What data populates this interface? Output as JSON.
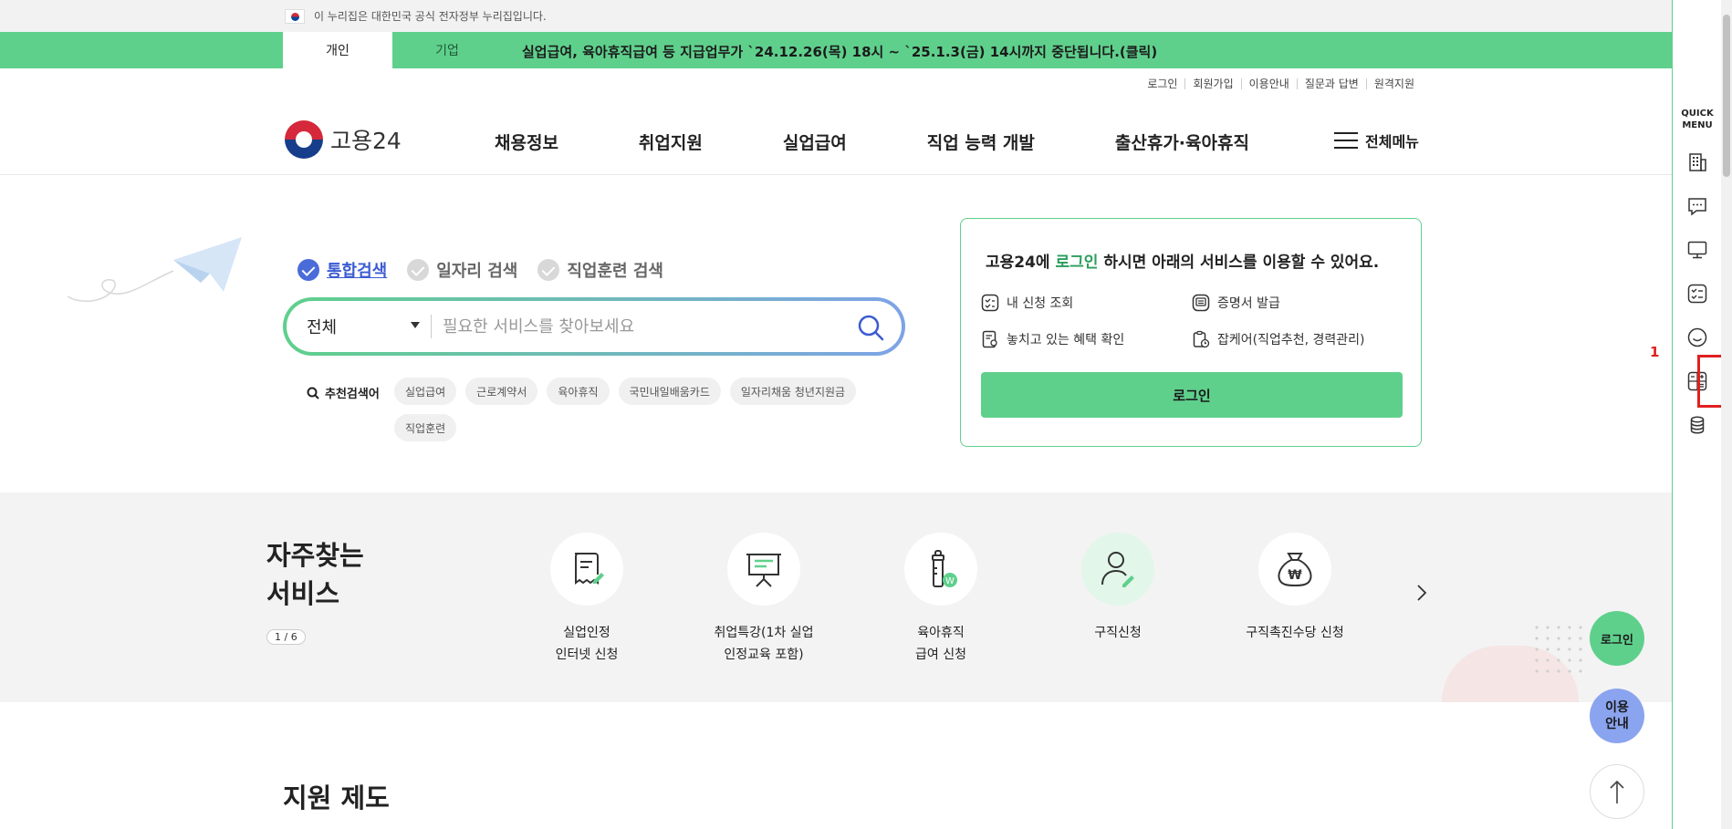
{
  "gov_banner": {
    "text": "이 누리집은 대한민국 공식 전자정부 누리집입니다."
  },
  "notice": {
    "tabs": [
      "개인",
      "기업"
    ],
    "text": "실업급여, 육아휴직급여 등 지급업무가 `24.12.26(목) 18시 ~ `25.1.3(금) 14시까지 중단됩니다.(클릭)"
  },
  "util_links": [
    "로그인",
    "회원가입",
    "이용안내",
    "질문과 답변",
    "원격지원"
  ],
  "header": {
    "logo_text": "고용24",
    "nav": [
      "채용정보",
      "취업지원",
      "실업급여",
      "직업 능력 개발",
      "출산휴가·육아휴직"
    ],
    "all_menu": "전체메뉴"
  },
  "search": {
    "tabs": [
      "통합검색",
      "일자리 검색",
      "직업훈련 검색"
    ],
    "select_value": "전체",
    "placeholder": "필요한 서비스를 찾아보세요",
    "recommend_label": "추천검색어",
    "tags": [
      "실업급여",
      "근로계약서",
      "육아휴직",
      "국민내일배움카드",
      "일자리채움 청년지원금",
      "직업훈련"
    ]
  },
  "login_box": {
    "title_pre": "고용24에 ",
    "title_hl": "로그인",
    "title_post": " 하시면 아래의 서비스를 이용할 수 있어요.",
    "services": [
      "내 신청 조회",
      "증명서 발급",
      "놓치고 있는 혜택 확인",
      "잡케어(직업추천, 경력관리)"
    ],
    "button": "로그인"
  },
  "frequent": {
    "title": "자주찾는\n서비스",
    "pager": "1 / 6",
    "items": [
      {
        "label": "실업인정\n인터넷 신청",
        "icon": "document-edit-icon"
      },
      {
        "label": "취업특강(1차 실업\n인정교육 포함)",
        "icon": "presentation-board-icon"
      },
      {
        "label": "육아휴직\n급여 신청",
        "icon": "baby-bottle-icon"
      },
      {
        "label": "구직신청",
        "icon": "person-edit-icon"
      },
      {
        "label": "구직촉진수당 신청",
        "icon": "money-bag-icon"
      }
    ]
  },
  "support": {
    "title": "지원 제도"
  },
  "floating": {
    "login": "로그인",
    "guide": "이용\n안내"
  },
  "quick_menu": {
    "title": "QUICK\nMENU",
    "icons": [
      "building-icon",
      "chat-icon",
      "monitor-icon",
      "checklist-icon",
      "smile-icon",
      "calculator-icon",
      "coins-icon"
    ]
  },
  "annotation": {
    "number": "1"
  },
  "colors": {
    "brand_green": "#5fd08c",
    "accent_blue": "#4b6bd8",
    "highlight_red": "#e02020"
  }
}
